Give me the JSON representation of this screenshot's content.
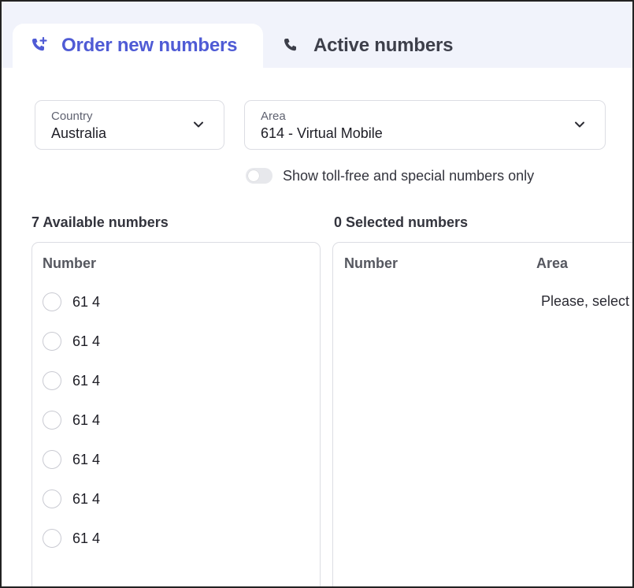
{
  "tabs": {
    "order": {
      "label": "Order new numbers",
      "icon": "phone-plus-icon",
      "active": true
    },
    "active": {
      "label": "Active numbers",
      "icon": "phone-icon",
      "active": false
    }
  },
  "filters": {
    "country": {
      "label": "Country",
      "value": "Australia"
    },
    "area": {
      "label": "Area",
      "value": "614 - Virtual Mobile"
    },
    "toll_free_toggle": {
      "label": "Show toll-free and special numbers only",
      "checked": false
    }
  },
  "available": {
    "title": "7 Available numbers",
    "column_header": "Number",
    "rows": [
      "61 4",
      "61 4",
      "61 4",
      "61 4",
      "61 4",
      "61 4",
      "61 4"
    ]
  },
  "selected": {
    "title": "0 Selected numbers",
    "columns": [
      "Number",
      "Area"
    ],
    "empty_message": "Please, select"
  },
  "colors": {
    "accent": "#4f5bd5",
    "tab_bar_bg": "#f1f3fb",
    "border": "#dcdde3"
  }
}
